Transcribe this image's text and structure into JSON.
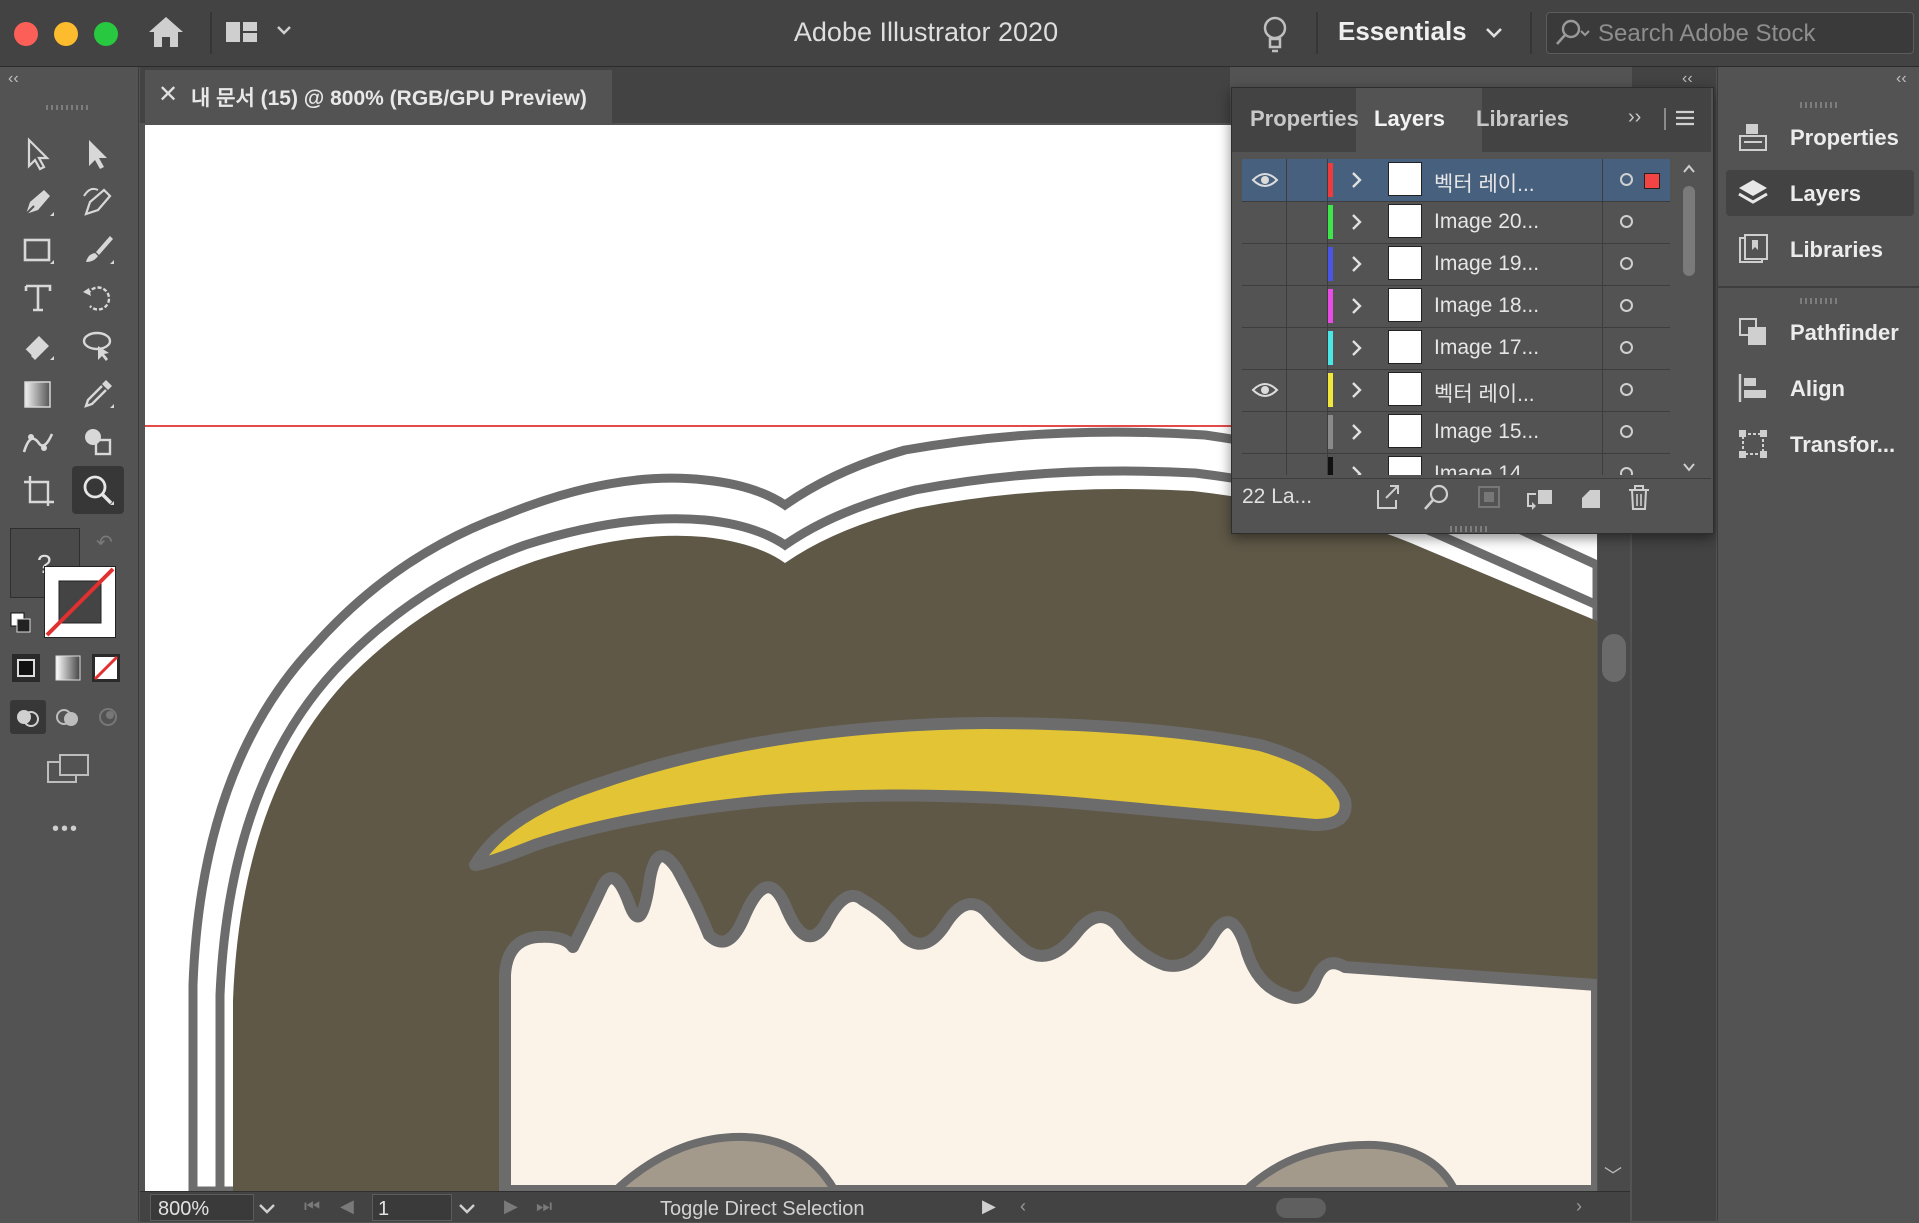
{
  "titlebar": {
    "app_title": "Adobe Illustrator 2020",
    "workspace": "Essentials",
    "search_placeholder": "Search Adobe Stock"
  },
  "document_tab": {
    "close_glyph": "✕",
    "title": "내 문서 (15) @ 800% (RGB/GPU Preview)"
  },
  "toolbar": {
    "collapse_glyph": "‹‹",
    "tools": [
      {
        "name": "selection-tool"
      },
      {
        "name": "direct-selection-tool"
      },
      {
        "name": "pen-tool"
      },
      {
        "name": "curvature-tool"
      },
      {
        "name": "rectangle-tool"
      },
      {
        "name": "paintbrush-tool"
      },
      {
        "name": "type-tool"
      },
      {
        "name": "rotate-tool"
      },
      {
        "name": "eraser-tool"
      },
      {
        "name": "lasso-tool"
      },
      {
        "name": "gradient-tool"
      },
      {
        "name": "eyedropper-tool"
      },
      {
        "name": "puppet-warp-tool"
      },
      {
        "name": "shape-builder-tool"
      },
      {
        "name": "artboard-tool"
      },
      {
        "name": "zoom-tool"
      }
    ],
    "fill_unknown_label": "?",
    "more_tools_glyph": "•••"
  },
  "layers_panel": {
    "tabs": [
      {
        "label": "Properties"
      },
      {
        "label": "Layers"
      },
      {
        "label": "Libraries"
      }
    ],
    "more_glyph": "››",
    "layers": [
      {
        "name": "벡터 레이...",
        "color": "#ef3b3b",
        "visible": true,
        "selected": true
      },
      {
        "name": "Image 20...",
        "color": "#3ee64b",
        "visible": false,
        "selected": false
      },
      {
        "name": "Image 19...",
        "color": "#4a55e6",
        "visible": false,
        "selected": false
      },
      {
        "name": "Image 18...",
        "color": "#e94be6",
        "visible": false,
        "selected": false
      },
      {
        "name": "Image 17...",
        "color": "#4be6e6",
        "visible": false,
        "selected": false
      },
      {
        "name": "벡터 레이...",
        "color": "#f0e63c",
        "visible": true,
        "selected": false
      },
      {
        "name": "Image 15...",
        "color": "#8a8a8a",
        "visible": false,
        "selected": false
      },
      {
        "name": "Image 14...",
        "color": "#111111",
        "visible": false,
        "selected": false
      }
    ],
    "count_label": "22 La..."
  },
  "statusbar": {
    "zoom": "800%",
    "page": "1",
    "status_text": "Toggle Direct Selection"
  },
  "right_dock": {
    "collapse_glyph": "‹‹",
    "items": [
      {
        "label": "Properties"
      },
      {
        "label": "Layers"
      },
      {
        "label": "Libraries"
      },
      {
        "label": "Pathfinder"
      },
      {
        "label": "Align"
      },
      {
        "label": "Transfor..."
      }
    ]
  },
  "colors": {
    "hair": "#5f5847",
    "outline": "#6c6c6c",
    "headband": "#e2c435",
    "skin": "#fbf3e8",
    "guide": "#e34a4a",
    "selection": "#46607e"
  }
}
